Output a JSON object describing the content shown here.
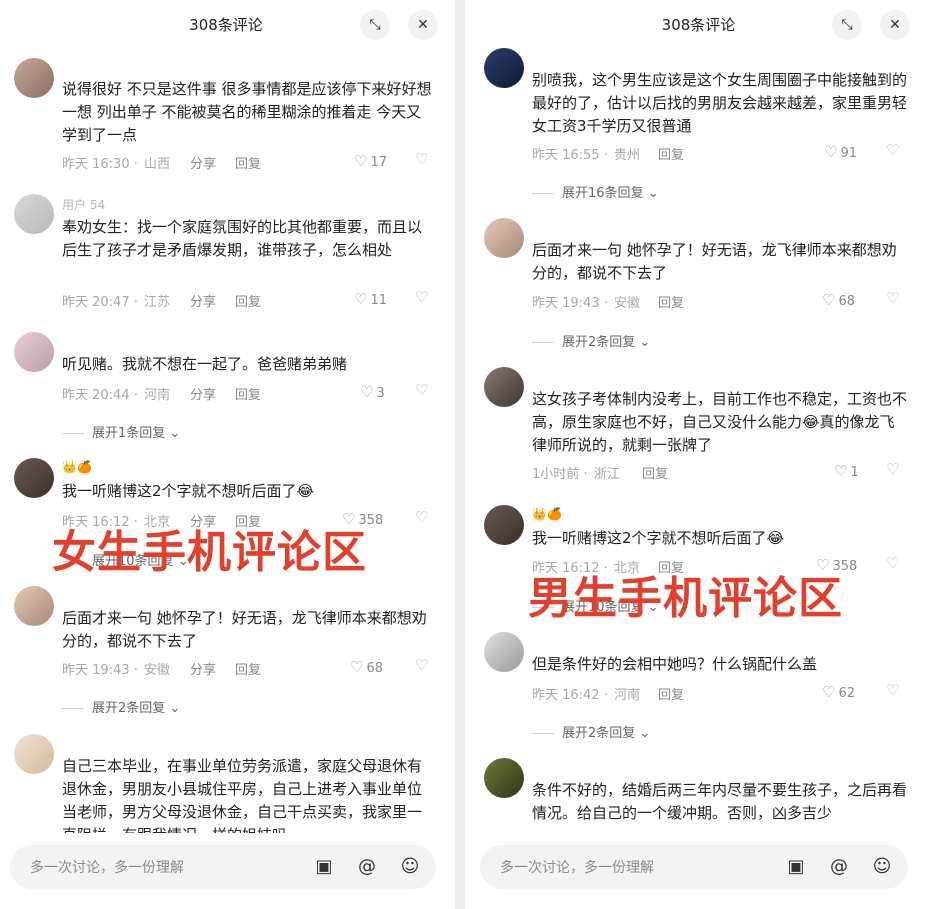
{
  "colors": {
    "overlay_text": "#e0402c",
    "like_icon": "#9a9a9a"
  },
  "left": {
    "header": {
      "title": "308条评论",
      "minimize_icon": "minimize-icon",
      "close_icon": "close-icon"
    },
    "overlay_label": "女生手机评论区",
    "comments": [
      {
        "text": "说得很好 不只是这件事 很多事情都是应该停下来好好想一想 列出单子 不能被莫名的稀里糊涂的推着走 今天又学到了一点",
        "time": "昨天 16:30",
        "location": "山西",
        "share": "分享",
        "reply": "回复",
        "likes": "17"
      },
      {
        "username": "用户 54",
        "text": "奉劝女生：找一个家庭氛围好的比其他都重要，而且以后生了孩子才是矛盾爆发期，谁带孩子，怎么相处",
        "time": "昨天 20:47",
        "location": "江苏",
        "share": "分享",
        "reply": "回复",
        "likes": "11"
      },
      {
        "text": "听见赌。我就不想在一起了。爸爸赌弟弟赌",
        "time": "昨天 20:44",
        "location": "河南",
        "share": "分享",
        "reply": "回复",
        "likes": "3",
        "expand": "展开1条回复"
      },
      {
        "text": "我一听赌博这2个字就不想听后面了😂",
        "time": "昨天 16:12",
        "location": "北京",
        "share": "分享",
        "reply": "回复",
        "likes": "358",
        "expand": "展开10条回复"
      },
      {
        "text": "后面才来一句 她怀孕了！好无语，龙飞律师本来都想劝分的，都说不下去了",
        "time": "昨天 19:43",
        "location": "安徽",
        "share": "分享",
        "reply": "回复",
        "likes": "68",
        "expand": "展开2条回复"
      },
      {
        "text": "自己三本毕业，在事业单位劳务派遣，家庭父母退休有退休金，男朋友小县城住平房，自己上进考入事业单位当老师，男方父母没退休金，自己干点买卖，我家里一直阻拦，有跟我情况一样的姐妹吗"
      }
    ],
    "input": {
      "placeholder": "多一次讨论，多一份理解"
    }
  },
  "right": {
    "header": {
      "title": "308条评论",
      "minimize_icon": "minimize-icon",
      "close_icon": "close-icon"
    },
    "overlay_label": "男生手机评论区",
    "comments": [
      {
        "text": "别喷我，这个男生应该是这个女生周围圈子中能接触到的最好的了，估计以后找的男朋友会越来越差，家里重男轻女工资3千学历又很普通",
        "time": "昨天 16:55",
        "location": "贵州",
        "reply": "回复",
        "likes": "91",
        "expand": "展开16条回复"
      },
      {
        "text": "后面才来一句 她怀孕了！好无语，龙飞律师本来都想劝分的，都说不下去了",
        "time": "昨天 19:43",
        "location": "安徽",
        "reply": "回复",
        "likes": "68",
        "expand": "展开2条回复"
      },
      {
        "text": "这女孩子考体制内没考上，目前工作也不稳定，工资也不高，原生家庭也不好，自己又没什么能力😂真的像龙飞律师所说的，就剩一张牌了",
        "time": "1小时前",
        "location": "浙江",
        "reply": "回复",
        "likes": "1"
      },
      {
        "text": "我一听赌博这2个字就不想听后面了😂",
        "time": "昨天 16:12",
        "location": "北京",
        "reply": "回复",
        "likes": "358",
        "expand": "展开10条回复"
      },
      {
        "text": "但是条件好的会相中她吗？什么锅配什么盖",
        "time": "昨天 16:42",
        "location": "河南",
        "reply": "回复",
        "likes": "62",
        "expand": "展开2条回复"
      },
      {
        "text": "条件不好的，结婚后两三年内尽量不要生孩子，之后再看情况。给自己的一个缓冲期。否则，凶多吉少"
      }
    ],
    "input": {
      "placeholder": "多一次讨论，多一份理解"
    }
  }
}
